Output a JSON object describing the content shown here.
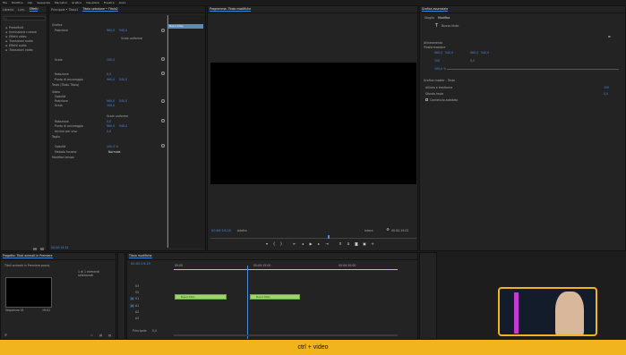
{
  "menubar": {
    "items": [
      "File",
      "Modifica",
      "Clip",
      "Sequenza",
      "Marcatori",
      "Grafica",
      "Visualizza",
      "Finestra",
      "Aiuto"
    ]
  },
  "project_panel": {
    "tabs": [
      "Libreria",
      "Lum.",
      "Effetti"
    ],
    "items": [
      "Predefiniti",
      "Immissione rumore",
      "Effetti video",
      "Transizioni audio",
      "Effetti audio",
      "Transizioni video"
    ]
  },
  "effect_controls": {
    "tabs": [
      "Principale • Titolo2",
      "Titolo selezione • Titolo2"
    ],
    "sections": [
      "Grafica",
      "Testo (Titolo Titolo)",
      "Video",
      "Modifica tempo"
    ],
    "properties": [
      "Posizione",
      "Scala",
      "Rotazione",
      "Punto di ancoraggio",
      "Opacità",
      "Taglio",
      "Anchor per viso"
    ],
    "values": [
      "960,0",
      "540,0",
      "100,0",
      "0,0",
      "100,0 %"
    ],
    "uniform_scale": "Scala uniforme",
    "blend_label": "Metodo fusione",
    "blend_value": "Normale",
    "timecode": "00:00:19:25"
  },
  "mini_timeline": {
    "clip_label": "Nuovo titolo"
  },
  "program_monitor": {
    "title": "Programma: Titolo modifiche",
    "timecode": "00:00:19:25",
    "fit": "Adatta",
    "quality": "Intera",
    "duration": "00:00:19:02"
  },
  "essential_graphics": {
    "title": "Grafica essenziale",
    "tabs": [
      "Sfoglia",
      "Modifica"
    ],
    "layer_name": "Nuovo titolo",
    "section_label": "Trasformazione",
    "sections": [
      "Grafica master - Testo",
      "Allineamento",
      "Sfondo testo"
    ],
    "values": [
      "960,0",
      "540,0",
      "100",
      "0,0",
      "100,0 %"
    ],
    "align_label": "Allinea e trasforma",
    "checkbox_label": "Contenuto adattato"
  },
  "project_bottom": {
    "title": "Progetto: Titoli animati in Premiere",
    "file": "Titoli animati in Premiere.prproj",
    "count": "1 di 1 elementi selezionati",
    "item_name": "Sequenza 01",
    "item_dur": "19:02"
  },
  "timeline": {
    "title": "Titolo modifiche",
    "timecode": "00:00:19:25",
    "ruler": [
      "00:00",
      "00:00:15:00",
      "00:00:30:00"
    ],
    "tracks": [
      "V3",
      "V2",
      "V1",
      "A1",
      "A2",
      "A3"
    ],
    "clips": [
      "Nuovo titolo",
      "Nuovo titolo"
    ],
    "footer_label": "Principale",
    "footer_value": "0,0"
  },
  "caption": {
    "text": "ctrl + video"
  },
  "colors": {
    "accent": "#f1b41c",
    "playhead": "#4a8de0",
    "clip": "#9cd66b"
  },
  "icons": [
    "search-icon",
    "play-icon",
    "stop-icon",
    "wrench-icon",
    "text-icon",
    "keyframe-icon"
  ]
}
